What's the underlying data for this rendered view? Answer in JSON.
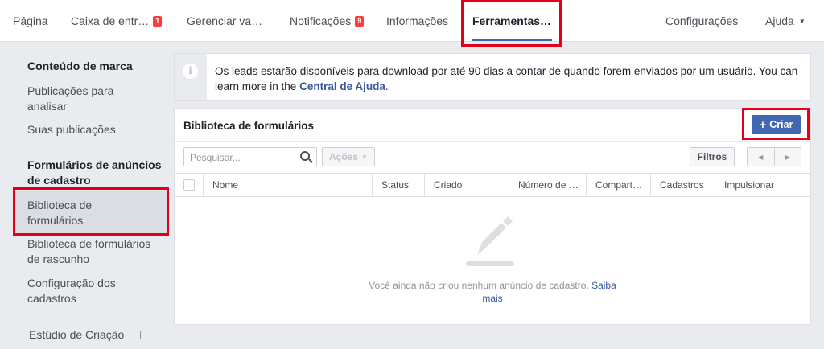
{
  "nav": {
    "tabs": [
      {
        "label": "Página"
      },
      {
        "label": "Caixa de entr…",
        "badge": "1"
      },
      {
        "label": "Gerenciar va…"
      },
      {
        "label": "Notificações",
        "badge": "9"
      },
      {
        "label": "Informações"
      },
      {
        "label": "Ferramentas…",
        "active": true
      },
      {
        "label": "Configurações"
      },
      {
        "label": "Ajuda"
      }
    ]
  },
  "sidebar": {
    "section1_title": "Conteúdo de marca",
    "section1_items": [
      "Publicações para analisar",
      "Suas publicações"
    ],
    "section2_title": "Formulários de anúncios de cadastro",
    "section2_items": [
      "Biblioteca de formulários",
      "Biblioteca de formulários de rascunho",
      "Configuração dos cadastros"
    ],
    "studio_label": "Estúdio de Criação"
  },
  "banner": {
    "text": "Os leads estarão disponíveis para download por até 90 dias a contar de quando forem enviados por um usuário. You can learn more in the",
    "link": "Central de Ajuda",
    "end": "."
  },
  "library": {
    "title": "Biblioteca de formulários",
    "create_label": "Criar",
    "search_placeholder": "Pesquisar...",
    "actions_label": "Ações",
    "filters_label": "Filtros",
    "columns": [
      "Nome",
      "Status",
      "Criado",
      "Número de …",
      "Compart…",
      "Cadastros",
      "Impulsionar"
    ],
    "empty_text": "Você ainda não criou nenhum anúncio de cadastro.",
    "empty_link": "Saiba mais"
  },
  "colors": {
    "accent": "#4267b2",
    "highlight": "#e1001a",
    "badge": "#fa3e3e"
  }
}
